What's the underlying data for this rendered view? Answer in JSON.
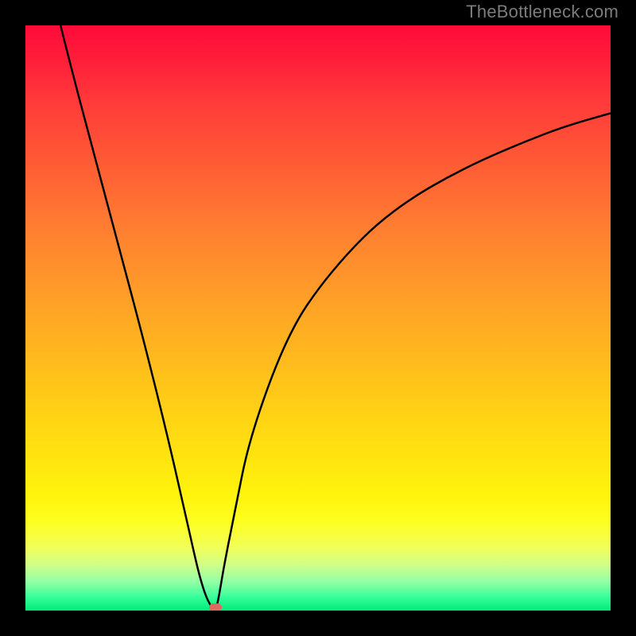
{
  "watermark_text": "TheBottleneck.com",
  "colors": {
    "curve_stroke": "#000000",
    "marker_fill": "#e06a5f",
    "background": "#000000"
  },
  "chart_data": {
    "type": "line",
    "title": "",
    "xlabel": "",
    "ylabel": "",
    "xlim": [
      0,
      100
    ],
    "ylim": [
      0,
      100
    ],
    "x": [
      6,
      8,
      12,
      16,
      20,
      24,
      27,
      29,
      30,
      31,
      32,
      32.5,
      33,
      34,
      36,
      38,
      42,
      46,
      50,
      55,
      60,
      66,
      72,
      78,
      85,
      92,
      100
    ],
    "values": [
      100,
      92,
      77,
      62,
      47,
      31,
      18,
      9,
      5,
      2,
      0.3,
      0,
      2,
      8,
      18,
      28,
      40,
      49,
      55,
      61,
      66,
      70.5,
      74,
      77,
      80,
      82.7,
      85
    ],
    "marker": {
      "x": 32.5,
      "y": 0.5,
      "shape": "rounded-pill"
    },
    "notes": "V-shaped bottleneck curve on a heatmap gradient; minimum near x≈32.5%."
  }
}
